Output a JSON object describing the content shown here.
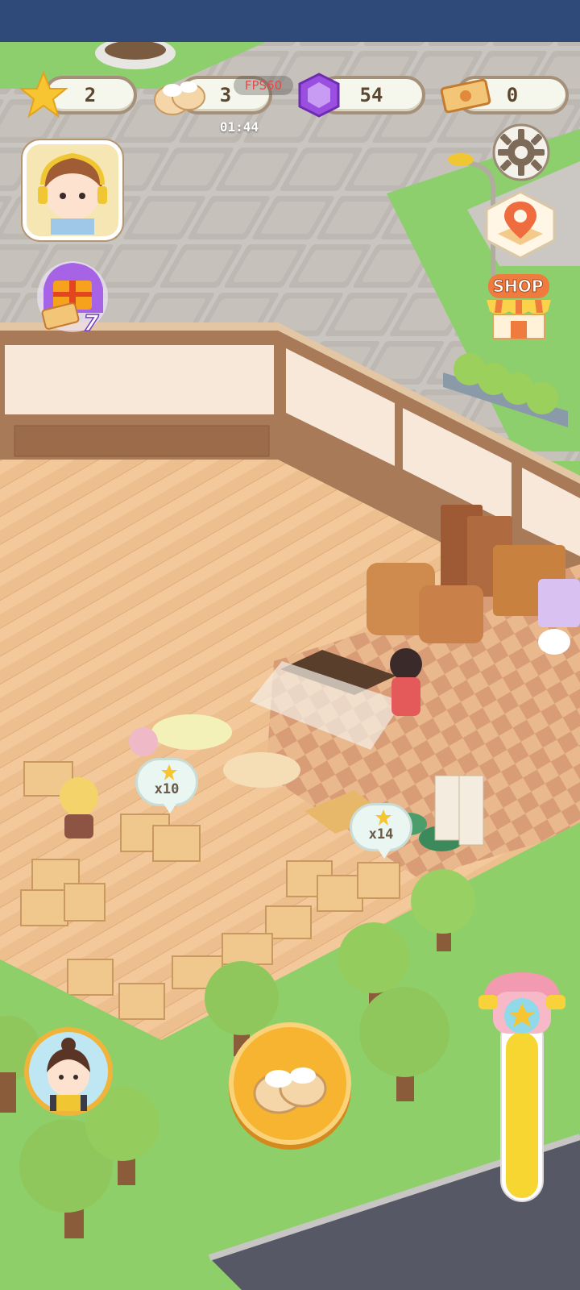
{
  "hud": {
    "stars": "2",
    "buns": "3",
    "gems": "54",
    "tickets": "0",
    "fps_label": "FPS60",
    "timer": "01:44"
  },
  "side_buttons": {
    "shop_label": "SHOP",
    "gift_count": "7"
  },
  "bubbles": [
    {
      "label": "x10"
    },
    {
      "label": "x14"
    }
  ],
  "icons": [
    "star-icon",
    "bun-icon",
    "gem-icon",
    "ticket-icon",
    "settings-gear-icon",
    "map-pin-icon",
    "shop-icon",
    "gift-icon",
    "telephone-icon",
    "bun-action-icon"
  ],
  "colors": {
    "status_bar": "#2f4a78",
    "accent_yellow": "#f7c531",
    "gem_purple": "#9b4fe0",
    "hud_border": "#a5907a"
  }
}
